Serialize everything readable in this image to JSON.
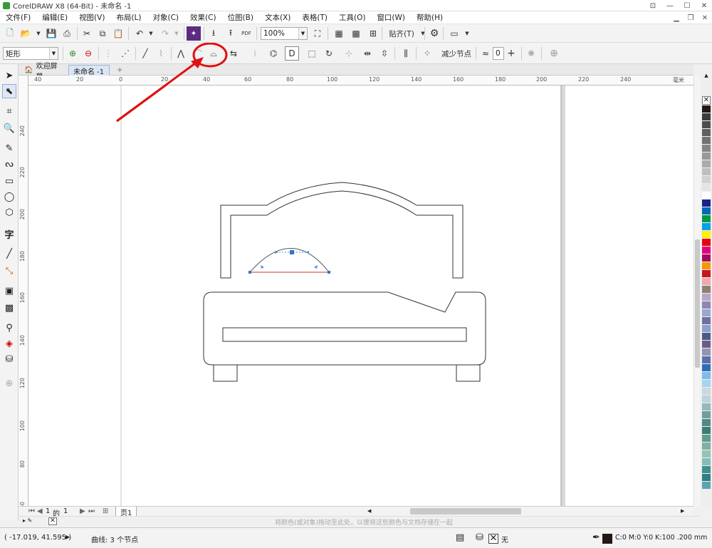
{
  "window": {
    "title": "CorelDRAW X8 (64-Bit) - 未命名 -1",
    "minimize_label": "—",
    "maximize_label": "☐",
    "close_label": "✕"
  },
  "menu": {
    "items": [
      "文件(F)",
      "编辑(E)",
      "视图(V)",
      "布局(L)",
      "对象(C)",
      "效果(C)",
      "位图(B)",
      "文本(X)",
      "表格(T)",
      "工具(O)",
      "窗口(W)",
      "帮助(H)"
    ]
  },
  "toolbar1": {
    "zoom_value": "100%",
    "snap_label": "贴齐(T)",
    "pdf_label": "PDF"
  },
  "toolbar2": {
    "shape_select": "矩形",
    "reduce_nodes_label": "减少节点",
    "curve_smoothness": "0"
  },
  "tabs": {
    "welcome": "欢迎屏幕",
    "document": "未命名 -1",
    "add": "+"
  },
  "ruler": {
    "h_labels": [
      "40",
      "20",
      "0",
      "20",
      "40",
      "60",
      "80",
      "100",
      "120",
      "140",
      "160",
      "180",
      "200",
      "220",
      "240"
    ],
    "h_unit": "毫米",
    "v_labels": [
      "240",
      "220",
      "200",
      "180",
      "160",
      "140",
      "120",
      "100",
      "80",
      "60"
    ]
  },
  "pager": {
    "current": "1",
    "of_label": "的",
    "total": "1",
    "page_tab": "页1"
  },
  "colorbar": {
    "hint": "将颜色(或对象)拖动至此处，以便将这些颜色与文档存储在一起"
  },
  "status": {
    "coords": "( -17.019, 41.595 )",
    "selection": "曲线: 3 个节点",
    "fill_none": "无",
    "outline_info": "C:0 M:0 Y:0 K:100  .200 mm"
  },
  "palette": {
    "colors": [
      "#231815",
      "#3b3b3b",
      "#4d4d4d",
      "#5f5f5f",
      "#727272",
      "#858585",
      "#989898",
      "#ababab",
      "#bebebe",
      "#d1d1d1",
      "#e4e4e4",
      "#ffffff",
      "#1d2088",
      "#0068b7",
      "#009944",
      "#00a0e9",
      "#fff100",
      "#e60012",
      "#e4007f",
      "#a40b5d",
      "#f39800",
      "#c8161e",
      "#eeaaaa",
      "#8f7f6f",
      "#b7a6c9",
      "#8b86b4",
      "#9aa7cf",
      "#6d6ea8",
      "#8da0cb",
      "#4b5a8a",
      "#6e5a86",
      "#9195b5",
      "#5b6fae",
      "#2c6fb8",
      "#7fbce8",
      "#a7d4ee",
      "#c9d9e3",
      "#bcd3d9",
      "#93b9b8",
      "#6e9f9b",
      "#4f8c85",
      "#3e7d73",
      "#5e9d8f",
      "#7fb0a3",
      "#97c2b4",
      "#84bdb5",
      "#3f8f8c",
      "#2e7f82",
      "#5aa6b0"
    ]
  }
}
